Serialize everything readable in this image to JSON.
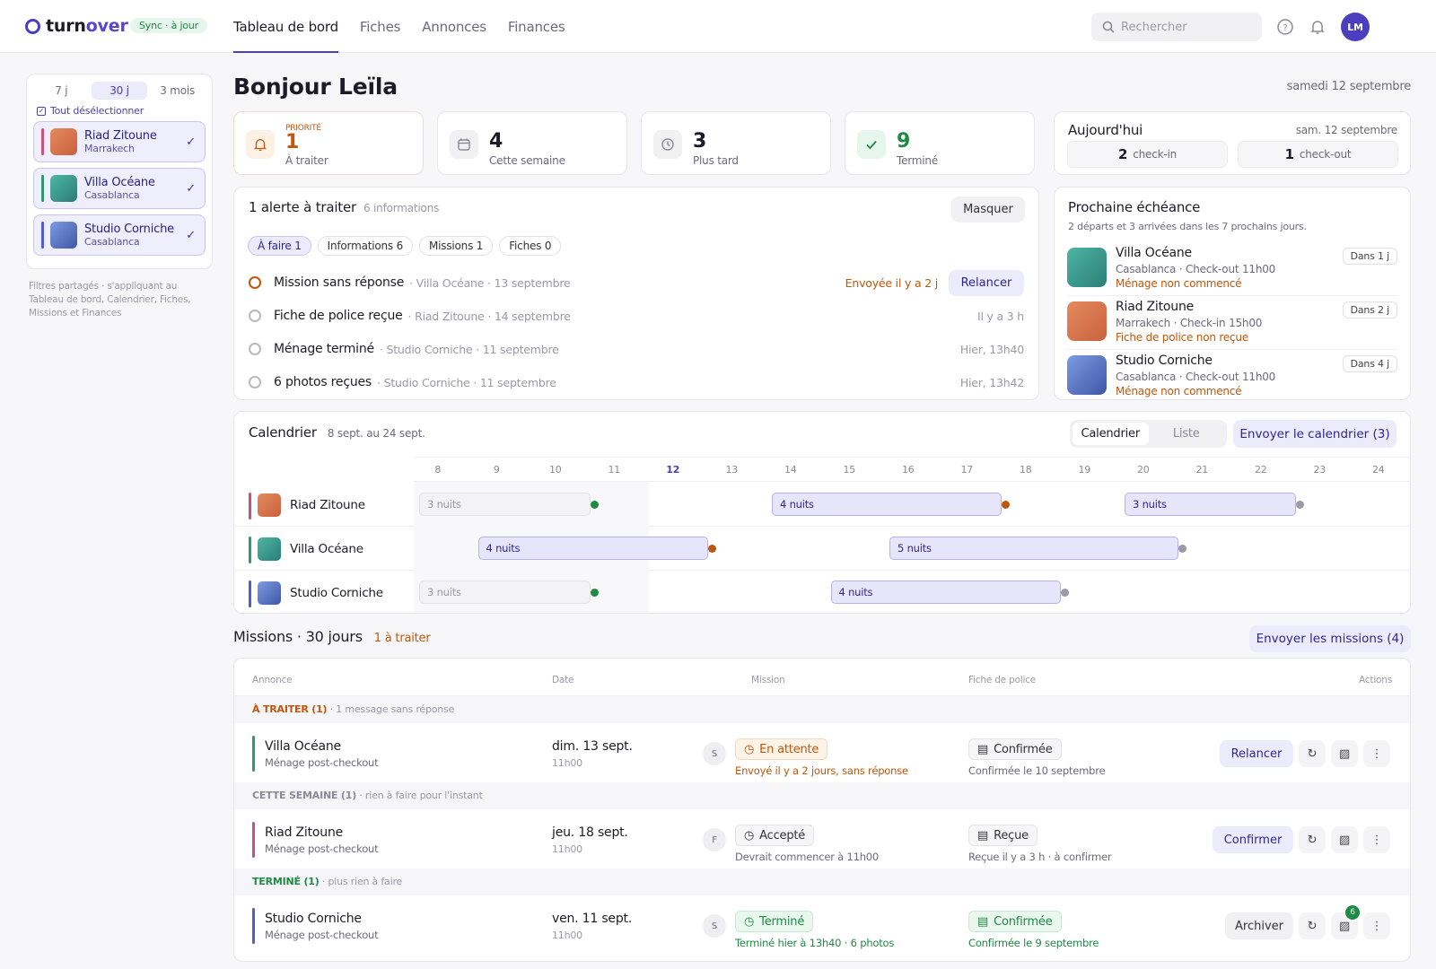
{
  "header": {
    "logo_a": "turn",
    "logo_b": "over",
    "sync_badge": "Sync · à jour",
    "nav": [
      "Tableau de bord",
      "Fiches",
      "Annonces",
      "Finances"
    ],
    "search_placeholder": "Rechercher",
    "avatar_initials": "LM"
  },
  "filters": {
    "ranges": [
      "7 j",
      "30 j",
      "3 mois"
    ],
    "selected_range": "30 j",
    "deselect_label": "Tout désélectionner",
    "properties": [
      {
        "name": "Riad Zitoune",
        "city": "Marrakech",
        "color": "#cf4f79"
      },
      {
        "name": "Villa Océane",
        "city": "Casablanca",
        "color": "#2f9a6c"
      },
      {
        "name": "Studio Corniche",
        "city": "Casablanca",
        "color": "#4f5fc8"
      }
    ],
    "note": "Filtres partagés · s'appliquant au Tableau de bord, Calendrier, Fiches, Missions et Finances"
  },
  "greeting": "Bonjour Leïla",
  "today_date": "samedi 12 septembre",
  "stats": [
    {
      "eyebrow": "PRIORITÉ",
      "value": "1",
      "label": "À traiter",
      "color": "#c0560b"
    },
    {
      "eyebrow": "",
      "value": "4",
      "label": "Cette semaine",
      "color": "#1c1c28"
    },
    {
      "eyebrow": "",
      "value": "3",
      "label": "Plus tard",
      "color": "#1c1c28"
    },
    {
      "eyebrow": "",
      "value": "9",
      "label": "Terminé",
      "color": "#1e8a44"
    }
  ],
  "today": {
    "title": "Aujourd'hui",
    "date": "sam. 12 septembre",
    "checkin_count": "2",
    "checkin_label": "check-in",
    "checkout_count": "1",
    "checkout_label": "check-out"
  },
  "alerts": {
    "title": "1 alerte à traiter",
    "subtitle": "6 informations",
    "hide_button": "Masquer",
    "tabs": [
      "À faire 1",
      "Informations 6",
      "Missions 1",
      "Fiches 0"
    ],
    "items": [
      {
        "title": "Mission sans réponse",
        "meta": "· Villa Océane · 13 septembre",
        "right": "Envoyée il y a 2 j",
        "action": "Relancer"
      },
      {
        "title": "Fiche de police reçue",
        "meta": "· Riad Zitoune · 14 septembre",
        "right": "Il y a 3 h"
      },
      {
        "title": "Ménage terminé",
        "meta": "· Studio Corniche · 11 septembre",
        "right": "Hier, 13h40"
      },
      {
        "title": "6 photos reçues",
        "meta": "· Studio Corniche · 11 septembre",
        "right": "Hier, 13h42"
      }
    ]
  },
  "deadline": {
    "title": "Prochaine échéance",
    "subtitle": "2 départs et 3 arrivées dans les 7 prochains jours.",
    "items": [
      {
        "name": "Villa Océane",
        "line": "Casablanca · Check-out 11h00",
        "warn": "Ménage non commencé",
        "tag": "Dans 1 j"
      },
      {
        "name": "Riad Zitoune",
        "line": "Marrakech · Check-in 15h00",
        "warn": "Fiche de police non reçue",
        "tag": "Dans 2 j"
      },
      {
        "name": "Studio Corniche",
        "line": "Casablanca · Check-out 11h00",
        "warn": "Ménage non commencé",
        "tag": "Dans 4 j"
      }
    ]
  },
  "calendar": {
    "title": "Calendrier",
    "range": "8 sept. au 24 sept.",
    "toggle": [
      "Calendrier",
      "Liste"
    ],
    "send_button": "Envoyer le calendrier (3)",
    "days": [
      "8",
      "9",
      "10",
      "11",
      "12",
      "13",
      "14",
      "15",
      "16",
      "17",
      "18",
      "19",
      "20",
      "21",
      "22",
      "23",
      "24"
    ],
    "today": "12",
    "rows": [
      {
        "name": "Riad Zitoune",
        "stays": [
          {
            "start": 8,
            "nights": 3,
            "label": "3 nuits",
            "status": "past",
            "dot": "#1e8a44"
          },
          {
            "start": 14,
            "nights": 4,
            "label": "4 nuits",
            "status": "future",
            "dot": "#c0560b"
          },
          {
            "start": 20,
            "nights": 3,
            "label": "3 nuits",
            "status": "future",
            "dot": "#9a9aa8"
          }
        ]
      },
      {
        "name": "Villa Océane",
        "stays": [
          {
            "start": 9,
            "nights": 4,
            "label": "4 nuits",
            "status": "future",
            "dot": "#c0560b"
          },
          {
            "start": 16,
            "nights": 5,
            "label": "5 nuits",
            "status": "future",
            "dot": "#9a9aa8"
          }
        ]
      },
      {
        "name": "Studio Corniche",
        "stays": [
          {
            "start": 8,
            "nights": 3,
            "label": "3 nuits",
            "status": "past",
            "dot": "#1e8a44"
          },
          {
            "start": 15,
            "nights": 4,
            "label": "4 nuits",
            "status": "future",
            "dot": "#9a9aa8"
          }
        ]
      }
    ]
  },
  "missions": {
    "title": "Missions · 30 jours",
    "todo_count": "1 à traiter",
    "send_button": "Envoyer les missions (4)",
    "columns": [
      "Annonce",
      "Date",
      "Mission",
      "Fiche de police",
      "Actions"
    ],
    "groups": [
      {
        "label": "À TRAITER (1)",
        "hint": "· 1 message sans réponse",
        "color": "#c0560b"
      },
      {
        "label": "CETTE SEMAINE (1)",
        "hint": "· rien à faire pour l'instant",
        "color": "#8a8a98"
      },
      {
        "label": "TERMINÉ (1)",
        "hint": "· plus rien à faire",
        "color": "#1e8a44"
      }
    ],
    "rows": [
      {
        "name": "Villa Océane",
        "sub": "Ménage post-checkout",
        "date": "dim. 13 sept.",
        "hour": "11h00",
        "initial": "S",
        "mission": "En attente",
        "mission_note": "Envoyé il y a 2 jours, sans réponse",
        "fiche": "Confirmée",
        "fiche_note": "Confirmée le 10 septembre",
        "action": "Relancer"
      },
      {
        "name": "Riad Zitoune",
        "sub": "Ménage post-checkout",
        "date": "jeu. 18 sept.",
        "hour": "11h00",
        "initial": "F",
        "mission": "Accepté",
        "mission_note": "Devrait commencer à 11h00",
        "fiche": "Reçue",
        "fiche_note": "Reçue il y a 3 h · à confirmer",
        "action": "Confirmer"
      },
      {
        "name": "Studio Corniche",
        "sub": "Ménage post-checkout",
        "date": "ven. 11 sept.",
        "hour": "11h00",
        "initial": "S",
        "mission": "Terminé",
        "mission_note": "Terminé hier à 13h40 · 6 photos",
        "fiche": "Confirmée",
        "fiche_note": "Confirmée le 9 septembre",
        "action": "Archiver",
        "photo_badge": "6"
      }
    ]
  }
}
